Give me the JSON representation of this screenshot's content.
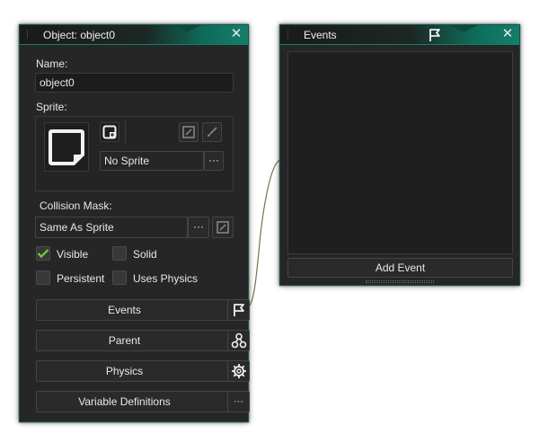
{
  "object_window": {
    "title": "Object: object0",
    "name_label": "Name:",
    "name_value": "object0",
    "sprite_label": "Sprite:",
    "sprite_value": "No Sprite",
    "sprite_menu": "···",
    "collision_label": "Collision Mask:",
    "collision_value": "Same As Sprite",
    "collision_menu": "···",
    "checkboxes": {
      "visible": {
        "label": "Visible",
        "checked": true
      },
      "solid": {
        "label": "Solid",
        "checked": false
      },
      "persistent": {
        "label": "Persistent",
        "checked": false
      },
      "uses_physics": {
        "label": "Uses Physics",
        "checked": false
      }
    },
    "buttons": {
      "events": "Events",
      "parent": "Parent",
      "physics": "Physics",
      "variable_definitions": "Variable Definitions",
      "variable_menu": "···"
    }
  },
  "events_window": {
    "title": "Events",
    "add_event": "Add Event"
  },
  "colors": {
    "accent": "#13816b",
    "check_green": "#6fc040",
    "window_bg": "#262626"
  },
  "icons": {
    "close": "✕",
    "flag": "flag-icon",
    "parent": "hierarchy-icon",
    "physics": "gear-icon"
  }
}
